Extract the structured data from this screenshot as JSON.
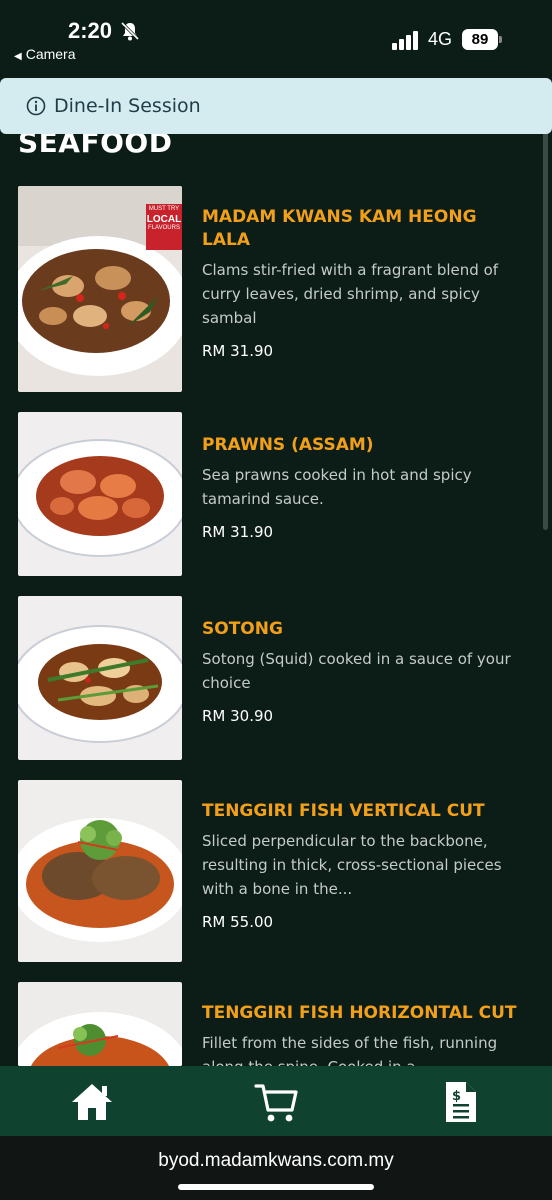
{
  "status_bar": {
    "time": "2:20",
    "back_label": "Camera",
    "network": "4G",
    "battery": "89"
  },
  "banner": {
    "label": "Dine-In Session"
  },
  "section": {
    "title": "SEAFOOD"
  },
  "items": [
    {
      "name": "MADAM KWANS KAM HEONG LALA",
      "description": "Clams stir-fried with a fragrant blend of curry leaves, dried shrimp, and spicy sambal",
      "price": "RM 31.90",
      "badge_top": "MUST TRY",
      "badge_mid": "LOCAL",
      "badge_bot": "FLAVOURS"
    },
    {
      "name": "PRAWNS (ASSAM)",
      "description": "Sea prawns cooked in hot and spicy tamarind sauce.",
      "price": "RM 31.90"
    },
    {
      "name": "SOTONG",
      "description": "Sotong (Squid) cooked in a sauce of your choice",
      "price": "RM 30.90"
    },
    {
      "name": "TENGGIRI FISH VERTICAL CUT",
      "description": "Sliced perpendicular to the backbone, resulting in thick, cross-sectional pieces with a bone in the...",
      "price": "RM 55.00"
    },
    {
      "name": "TENGGIRI FISH HORIZONTAL CUT",
      "description": "Fillet from the sides of the fish, running along the spine. Cooked in a"
    }
  ],
  "bottom_nav": {
    "home_icon": "home-icon",
    "cart_icon": "cart-icon",
    "orders_icon": "receipt-icon"
  },
  "browser": {
    "url": "byod.madamkwans.com.my"
  },
  "colors": {
    "background": "#0c1c17",
    "accent_orange": "#f2a01a",
    "nav_green": "#0f4330",
    "banner_bg": "#d4ebef"
  }
}
